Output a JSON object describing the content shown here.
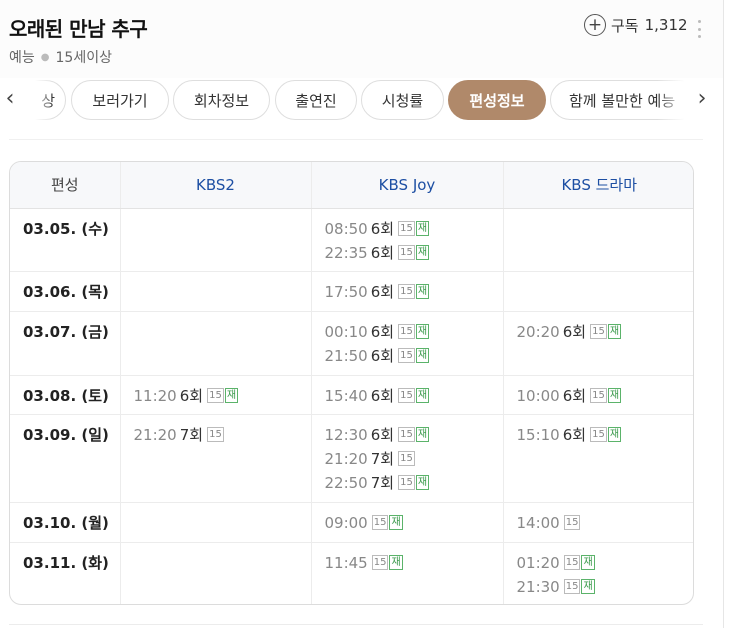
{
  "header": {
    "title": "오래된 만남 추구",
    "genre": "예능",
    "rating": "15세이상",
    "subscribe_label": "구독",
    "subscribe_count": "1,312",
    "icons": {
      "subscribe": "plus-circle-icon",
      "more": "more-vertical-icon"
    }
  },
  "tabs": [
    {
      "label": "상"
    },
    {
      "label": "보러가기"
    },
    {
      "label": "회차정보"
    },
    {
      "label": "출연진"
    },
    {
      "label": "시청률"
    },
    {
      "label": "편성정보",
      "active": true
    },
    {
      "label": "함께 볼만한 예능"
    }
  ],
  "nav": {
    "prev": "‹",
    "next": "›"
  },
  "schedule": {
    "headers": [
      "편성",
      "KBS2",
      "KBS Joy",
      "KBS 드라마"
    ],
    "rows": [
      {
        "date": "03.05. (수)",
        "cells": [
          [],
          [
            {
              "time": "08:50",
              "ep": "6회",
              "age": "15",
              "rerun": "재"
            },
            {
              "time": "22:35",
              "ep": "6회",
              "age": "15",
              "rerun": "재"
            }
          ],
          []
        ]
      },
      {
        "date": "03.06. (목)",
        "cells": [
          [],
          [
            {
              "time": "17:50",
              "ep": "6회",
              "age": "15",
              "rerun": "재"
            }
          ],
          []
        ]
      },
      {
        "date": "03.07. (금)",
        "cells": [
          [],
          [
            {
              "time": "00:10",
              "ep": "6회",
              "age": "15",
              "rerun": "재"
            },
            {
              "time": "21:50",
              "ep": "6회",
              "age": "15",
              "rerun": "재"
            }
          ],
          [
            {
              "time": "20:20",
              "ep": "6회",
              "age": "15",
              "rerun": "재"
            }
          ]
        ]
      },
      {
        "date": "03.08. (토)",
        "cells": [
          [
            {
              "time": "11:20",
              "ep": "6회",
              "age": "15",
              "rerun": "재"
            }
          ],
          [
            {
              "time": "15:40",
              "ep": "6회",
              "age": "15",
              "rerun": "재"
            }
          ],
          [
            {
              "time": "10:00",
              "ep": "6회",
              "age": "15",
              "rerun": "재"
            }
          ]
        ]
      },
      {
        "date": "03.09. (일)",
        "cells": [
          [
            {
              "time": "21:20",
              "ep": "7회",
              "age": "15",
              "rerun": ""
            }
          ],
          [
            {
              "time": "12:30",
              "ep": "6회",
              "age": "15",
              "rerun": "재"
            },
            {
              "time": "21:20",
              "ep": "7회",
              "age": "15",
              "rerun": ""
            },
            {
              "time": "22:50",
              "ep": "7회",
              "age": "15",
              "rerun": "재"
            }
          ],
          [
            {
              "time": "15:10",
              "ep": "6회",
              "age": "15",
              "rerun": "재"
            }
          ]
        ]
      },
      {
        "date": "03.10. (월)",
        "cells": [
          [],
          [
            {
              "time": "09:00",
              "ep": "",
              "age": "15",
              "rerun": "재"
            }
          ],
          [
            {
              "time": "14:00",
              "ep": "",
              "age": "15",
              "rerun": ""
            }
          ]
        ]
      },
      {
        "date": "03.11. (화)",
        "cells": [
          [],
          [
            {
              "time": "11:45",
              "ep": "",
              "age": "15",
              "rerun": "재"
            }
          ],
          [
            {
              "time": "01:20",
              "ep": "",
              "age": "15",
              "rerun": "재"
            },
            {
              "time": "21:30",
              "ep": "",
              "age": "15",
              "rerun": "재"
            }
          ]
        ]
      }
    ]
  },
  "colors": {
    "active_tab": "#b0896a",
    "channel_header": "#1d4fa3",
    "rerun_badge": "#3a9a4b"
  }
}
